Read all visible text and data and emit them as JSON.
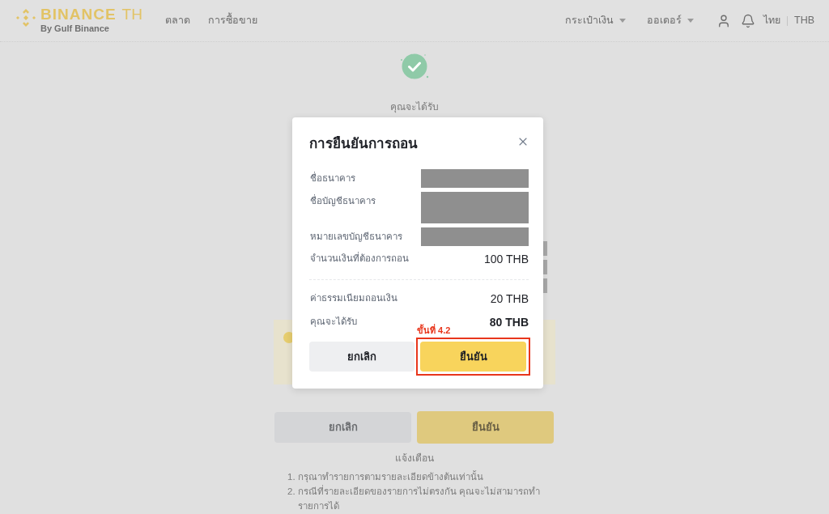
{
  "header": {
    "logo": {
      "name": "BINANCE",
      "suffix": "TH",
      "tagline": "By Gulf Binance"
    },
    "nav": [
      "ตลาด",
      "การซื้อขาย"
    ],
    "menus": [
      "กระเป๋าเงิน",
      "ออเดอร์"
    ],
    "language": "ไทย",
    "currency": "THB"
  },
  "page": {
    "status_label": "คุณจะได้รับ",
    "buttons": [
      {
        "label": "ยกเลิก",
        "kind": "secondary"
      },
      {
        "label": "ยืนยัน",
        "kind": "primary"
      }
    ],
    "notice": {
      "title": "แจ้งเตือน",
      "items": [
        {
          "number": "1.",
          "text": "กรุณาทำรายการตามรายละเอียดข้างต้นเท่านั้น"
        },
        {
          "number": "2.",
          "text": "กรณีที่รายละเอียดของรายการไม่ตรงกัน คุณจะไม่สามารถทำรายการได้"
        }
      ]
    }
  },
  "dialog": {
    "title": "การยืนยันการถอน",
    "rows": [
      {
        "label": "ชื่อธนาคาร",
        "kind": "masked"
      },
      {
        "label": "ชื่อบัญชีธนาคาร",
        "kind": "tallmasked"
      },
      {
        "label": "หมายเลขบัญชีธนาคาร",
        "kind": "masked"
      },
      {
        "label": "จำนวนเงินที่ต้องการถอน",
        "kind": "amount",
        "value": "100 THB"
      }
    ],
    "summary": [
      {
        "label": "ค่าธรรมเนียมถอนเงิน",
        "kind": "amount",
        "value": "20 THB"
      },
      {
        "label": "คุณจะได้รับ",
        "kind": "total",
        "value": "80 THB"
      }
    ],
    "annotation": "ขั้นที่ 4.2",
    "buttons": [
      {
        "label": "ยกเลิก",
        "kind": "secondary",
        "highlighted": false
      },
      {
        "label": "ยืนยัน",
        "kind": "primary",
        "highlighted": true
      }
    ]
  }
}
